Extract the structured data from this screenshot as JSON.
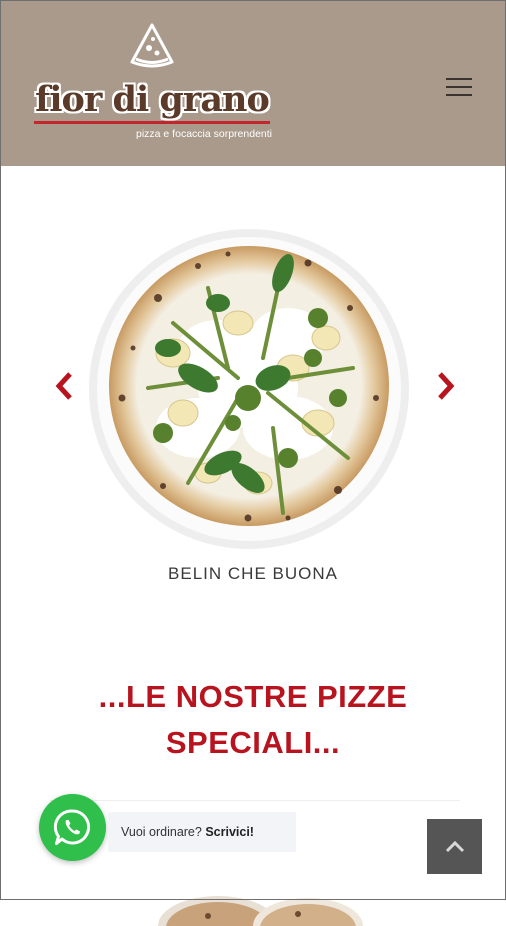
{
  "header": {
    "logo": {
      "title": "fior di grano",
      "tagline": "pizza e focaccia sorprendenti",
      "icon": "pizza-slice-icon"
    },
    "menu_icon": "hamburger-menu-icon"
  },
  "carousel": {
    "current_caption": "BELIN CHE BUONA",
    "prev_icon": "chevron-left-icon",
    "next_icon": "chevron-right-icon"
  },
  "section": {
    "title_line1": "...LE NOSTRE PIZZE",
    "title_line2": "SPECIALI..."
  },
  "whatsapp": {
    "prompt": "Vuoi ordinare?",
    "cta": "Scrivici!",
    "icon": "whatsapp-icon"
  },
  "back_to_top_icon": "chevron-up-icon",
  "colors": {
    "header_bg": "#a99a8b",
    "accent_red": "#b8141f",
    "whatsapp_green": "#2fbf4a",
    "back_to_top_bg": "#555555"
  }
}
